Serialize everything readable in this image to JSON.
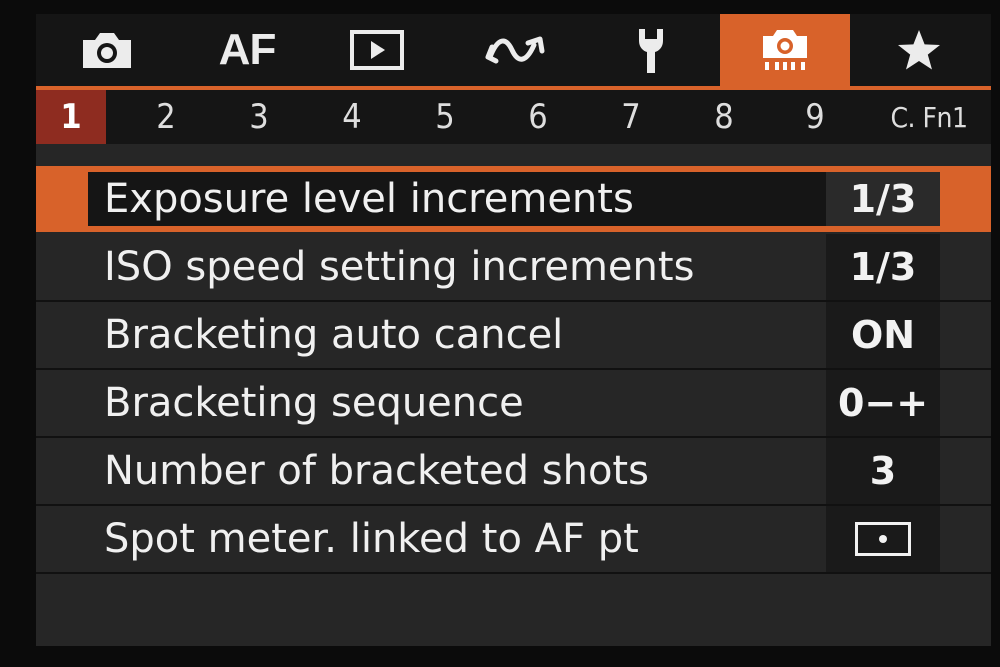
{
  "tabs": [
    {
      "icon": "camera-icon"
    },
    {
      "label": "AF"
    },
    {
      "icon": "playback-icon"
    },
    {
      "icon": "wireless-icon"
    },
    {
      "icon": "wrench-icon"
    },
    {
      "icon": "custom-function-icon",
      "active": true
    },
    {
      "icon": "star-icon"
    }
  ],
  "pages": [
    "1",
    "2",
    "3",
    "4",
    "5",
    "6",
    "7",
    "8",
    "9",
    "C. Fn1"
  ],
  "active_page": "1",
  "menu": {
    "items": [
      {
        "label": "Exposure level increments",
        "value": "1/3",
        "selected": true
      },
      {
        "label": "ISO speed setting increments",
        "value": "1/3"
      },
      {
        "label": "Bracketing auto cancel",
        "value": "ON"
      },
      {
        "label": "Bracketing sequence",
        "value": "0−+"
      },
      {
        "label": "Number of bracketed shots",
        "value": "3"
      },
      {
        "label": "Spot meter. linked to AF pt",
        "value_icon": "spot-meter-icon"
      }
    ]
  },
  "colors": {
    "accent": "#d8622a",
    "active_page": "#8e2c20",
    "background": "#262626"
  }
}
